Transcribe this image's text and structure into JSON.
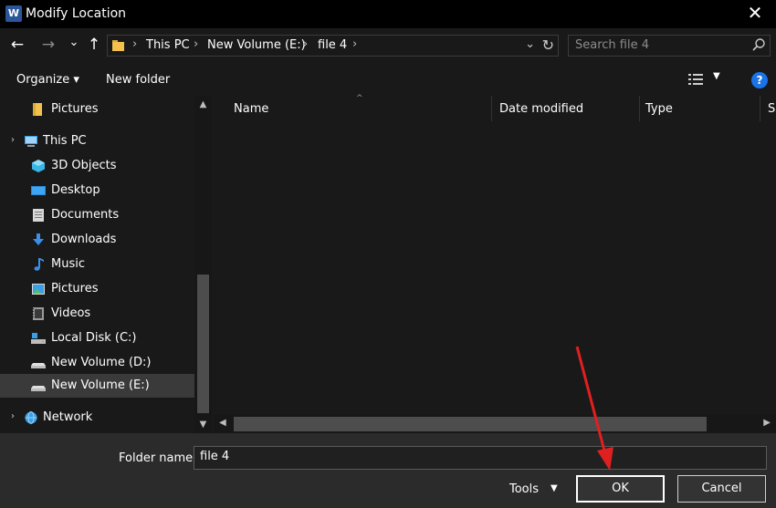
{
  "window": {
    "title": "Modify Location",
    "app_icon_letter": "W",
    "close_glyph": "✕"
  },
  "nav": {
    "back_glyph": "←",
    "forward_glyph": "→",
    "recent_glyph": "⌄",
    "up_glyph": "↑"
  },
  "address": {
    "crumbs": [
      "This PC",
      "New Volume (E:)",
      "file 4"
    ],
    "separator": "›",
    "dropdown_glyph": "⌄",
    "refresh_glyph": "↻"
  },
  "search": {
    "placeholder": "Search file 4"
  },
  "toolbar": {
    "organize_label": "Organize ▾",
    "new_folder_label": "New folder",
    "view_dropdown_glyph": "▼",
    "help_glyph": "?"
  },
  "sidebar": {
    "items": [
      {
        "label": "Pictures",
        "icon": "folder-icon"
      },
      {
        "label": "This PC",
        "icon": "computer-icon"
      },
      {
        "label": "3D Objects",
        "icon": "3d-objects-icon"
      },
      {
        "label": "Desktop",
        "icon": "desktop-icon"
      },
      {
        "label": "Documents",
        "icon": "documents-icon"
      },
      {
        "label": "Downloads",
        "icon": "downloads-icon"
      },
      {
        "label": "Music",
        "icon": "music-icon"
      },
      {
        "label": "Pictures",
        "icon": "pictures-icon"
      },
      {
        "label": "Videos",
        "icon": "videos-icon"
      },
      {
        "label": "Local Disk (C:)",
        "icon": "local-disk-icon"
      },
      {
        "label": "New Volume (D:)",
        "icon": "drive-icon"
      },
      {
        "label": "New Volume (E:)",
        "icon": "drive-icon",
        "selected": true
      },
      {
        "label": "Network",
        "icon": "network-icon"
      }
    ],
    "chevron_glyph": "›"
  },
  "columns": {
    "name": "Name",
    "date_modified": "Date modified",
    "type": "Type",
    "size": "S"
  },
  "footer": {
    "folder_name_label": "Folder name:",
    "folder_name_value": "file 4",
    "tools_label": "Tools",
    "tools_drop_glyph": "▼",
    "ok_label": "OK",
    "cancel_label": "Cancel"
  },
  "colors": {
    "background": "#191919",
    "titlebar": "#000000",
    "selected_item": "#3a3a3a",
    "help_blue": "#1a73e8",
    "annotation_arrow": "#e02020",
    "folder_yellow": "#f2c14e"
  }
}
